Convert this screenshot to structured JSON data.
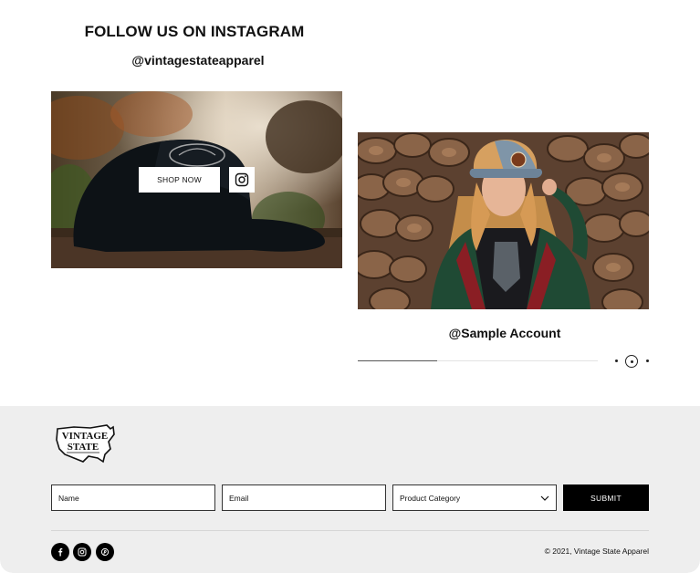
{
  "instagram": {
    "title": "FOLLOW US ON INSTAGRAM",
    "handle": "@vintagestateapparel",
    "shop_now_label": "SHOP NOW",
    "account_label": "@Sample Account",
    "carousel_progress_percent": 33
  },
  "form": {
    "name_placeholder": "Name",
    "email_placeholder": "Email",
    "category_label": "Product Category",
    "submit_label": "SUBMIT"
  },
  "footer": {
    "logo_text_line1": "VINTAGE",
    "logo_text_line2": "STATE",
    "copyright": "© 2021, Vintage State Apparel",
    "social_icons": [
      "facebook-icon",
      "instagram-icon",
      "pinterest-icon"
    ]
  },
  "colors": {
    "footer_bg": "#eeeeee",
    "submit_bg": "#000000",
    "accent_cap_orange": "#c8843c"
  }
}
